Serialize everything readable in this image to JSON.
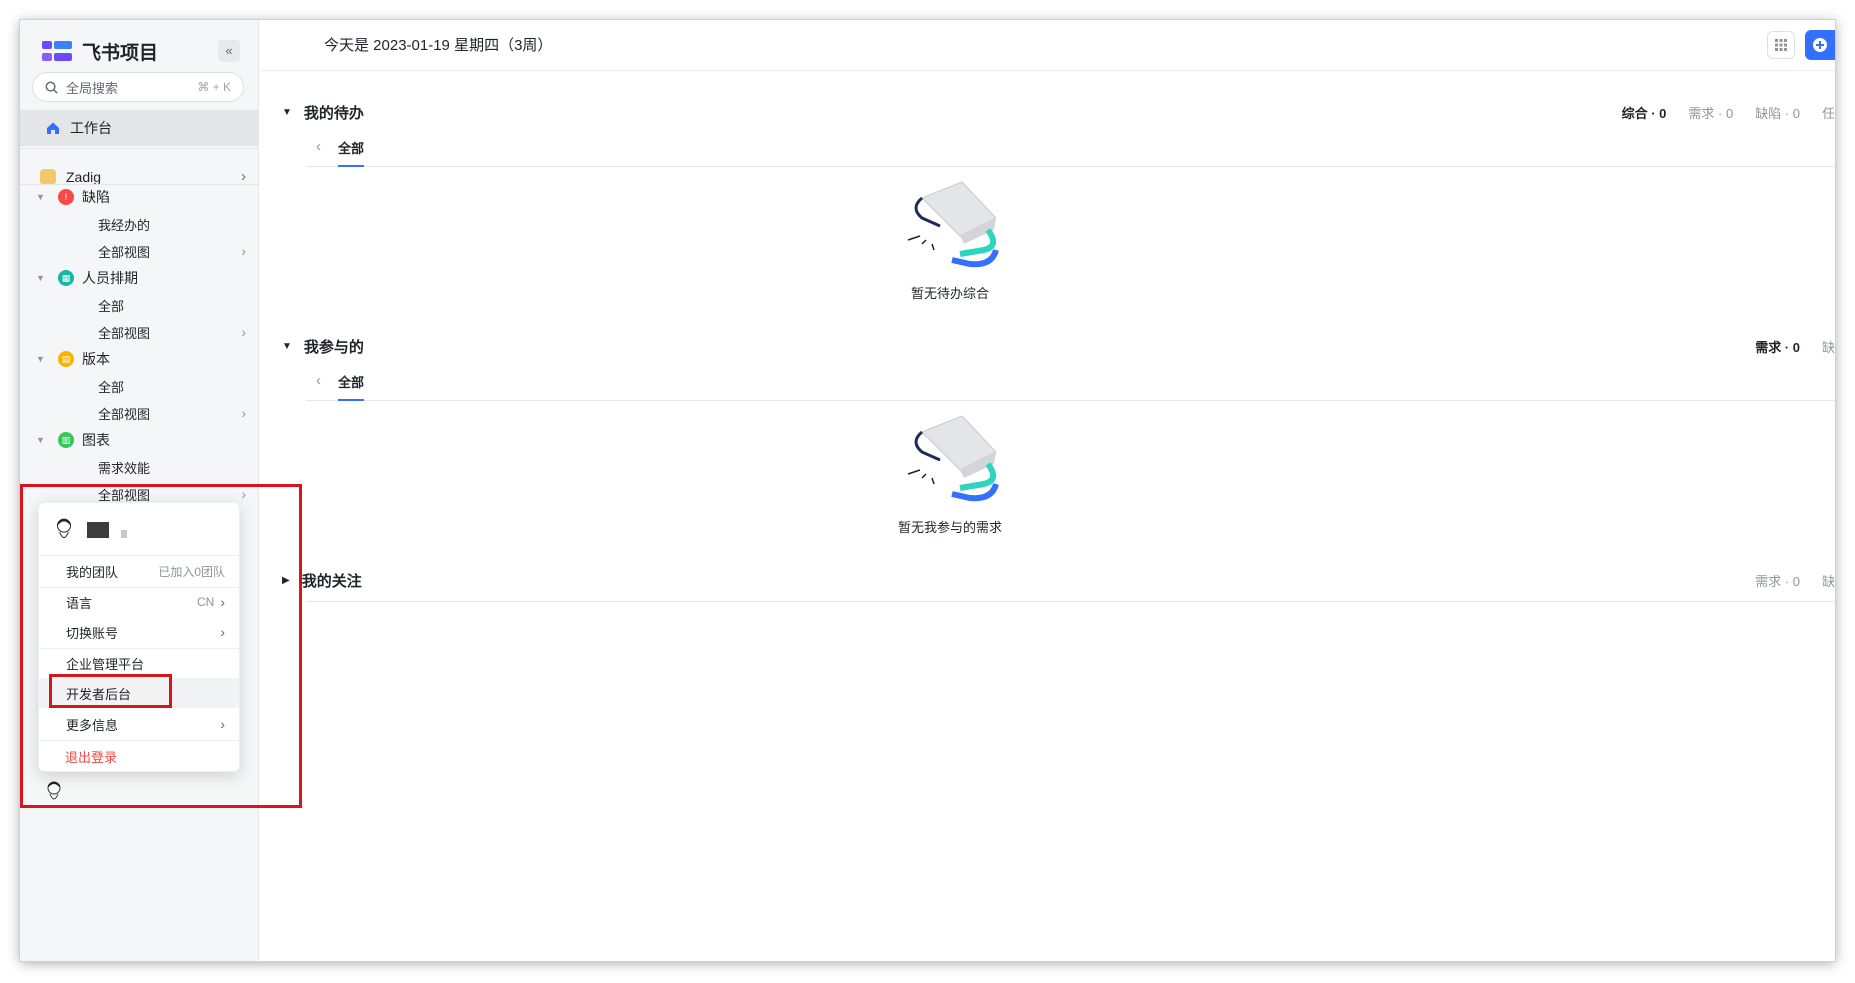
{
  "app": {
    "name": "飞书项目"
  },
  "sidebar": {
    "collapse_icon": "«",
    "search": {
      "placeholder": "全局搜索",
      "shortcut": "⌘ + K"
    },
    "workbench": "工作台",
    "space": {
      "name": "Zadig"
    },
    "groups": [
      {
        "label": "缺陷",
        "color": "#f54a45",
        "icon": "bug-icon",
        "subs": [
          {
            "label": "我经办的"
          },
          {
            "label": "全部视图"
          }
        ]
      },
      {
        "label": "人员排期",
        "color": "#14b8a6",
        "icon": "calendar-grid-icon",
        "subs": [
          {
            "label": "全部"
          },
          {
            "label": "全部视图"
          }
        ]
      },
      {
        "label": "版本",
        "color": "#f5b400",
        "icon": "version-icon",
        "subs": [
          {
            "label": "全部"
          },
          {
            "label": "全部视图"
          }
        ]
      },
      {
        "label": "图表",
        "color": "#34c759",
        "icon": "chart-icon",
        "subs": [
          {
            "label": "需求效能"
          },
          {
            "label": "全部视图"
          }
        ]
      }
    ]
  },
  "topbar": {
    "date_text": "今天是 2023-01-19 星期四（3周）"
  },
  "sections": {
    "todo": {
      "title": "我的待办",
      "stats": [
        "综合 · 0",
        "需求 · 0",
        "缺陷 · 0",
        "任"
      ],
      "tab": "全部",
      "empty": "暂无待办综合"
    },
    "participated": {
      "title": "我参与的",
      "stats": [
        "需求 · 0",
        "缺"
      ],
      "tab": "全部",
      "empty": "暂无我参与的需求"
    },
    "following": {
      "title": "我的关注",
      "stats": [
        "需求 · 0",
        "缺"
      ]
    }
  },
  "user_menu": {
    "my_team": {
      "label": "我的团队",
      "value": "已加入0团队"
    },
    "language": {
      "label": "语言",
      "value": "CN"
    },
    "switch_account": "切换账号",
    "enterprise_admin": "企业管理平台",
    "developer_console": "开发者后台",
    "more_info": "更多信息",
    "logout": "退出登录"
  },
  "colors": {
    "accent": "#3370ff",
    "highlight_box": "#d8141d",
    "danger": "#f54a45"
  }
}
